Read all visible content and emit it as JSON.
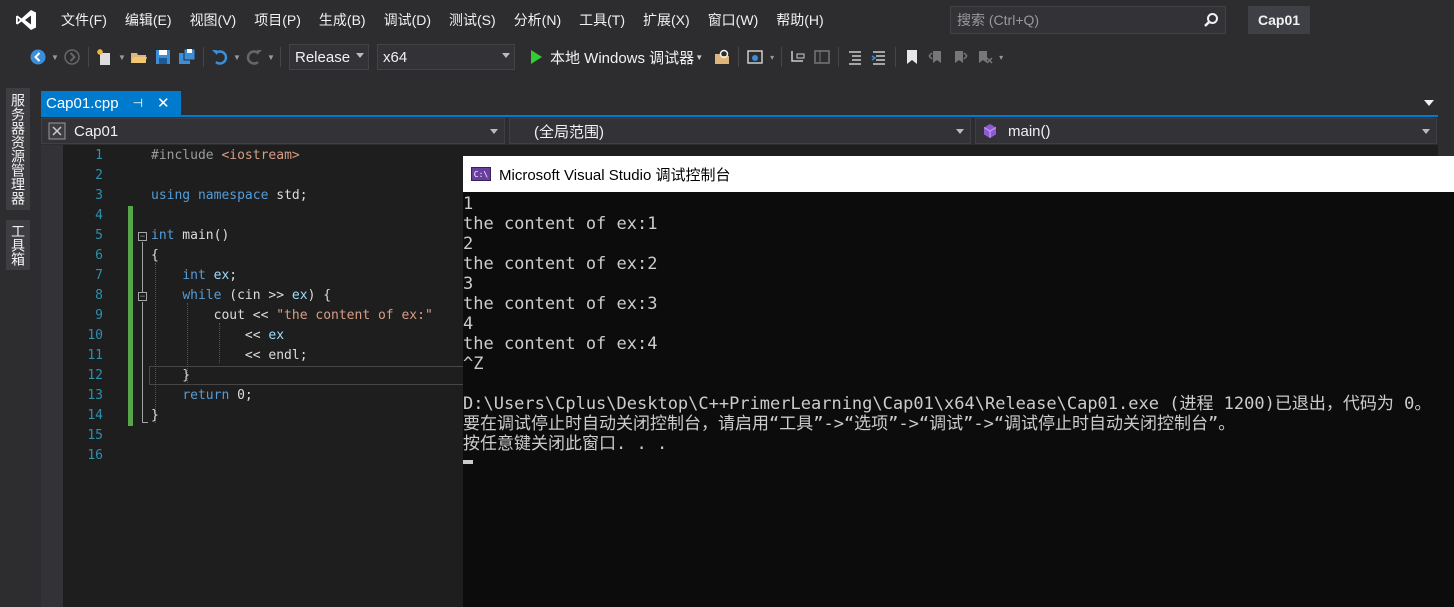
{
  "menubar": {
    "items": [
      "文件(F)",
      "编辑(E)",
      "视图(V)",
      "项目(P)",
      "生成(B)",
      "调试(D)",
      "测试(S)",
      "分析(N)",
      "工具(T)",
      "扩展(X)",
      "窗口(W)",
      "帮助(H)"
    ],
    "search_placeholder": "搜索 (Ctrl+Q)",
    "project_name": "Cap01"
  },
  "toolbar": {
    "configuration": "Release",
    "platform": "x64",
    "debug_label": "本地 Windows 调试器"
  },
  "side_tabs": [
    "服务器资源管理器",
    "工具箱"
  ],
  "document_tab": {
    "filename": "Cap01.cpp"
  },
  "navbar": {
    "project": "Cap01",
    "scope": "(全局范围)",
    "member": "main()"
  },
  "editor": {
    "line_numbers": [
      "1",
      "2",
      "3",
      "4",
      "5",
      "6",
      "7",
      "8",
      "9",
      "10",
      "11",
      "12",
      "13",
      "14",
      "15",
      "16"
    ]
  },
  "console": {
    "title": "Microsoft Visual Studio 调试控制台",
    "lines": [
      "1",
      "the content of ex:1",
      "2",
      "the content of ex:2",
      "3",
      "the content of ex:3",
      "4",
      "the content of ex:4",
      "^Z",
      "",
      "D:\\Users\\Cplus\\Desktop\\C++PrimerLearning\\Cap01\\x64\\Release\\Cap01.exe (进程 1200)已退出，代码为 0。",
      "要在调试停止时自动关闭控制台，请启用“工具”->“选项”->“调试”->“调试停止时自动关闭控制台”。",
      "按任意键关闭此窗口. . ."
    ]
  },
  "colors": {
    "accent": "#007acc",
    "editor_bg": "#1e1e1e",
    "chrome_bg": "#2d2d30",
    "console_bg": "#0c0c0c",
    "change_bar": "#57a64a"
  }
}
